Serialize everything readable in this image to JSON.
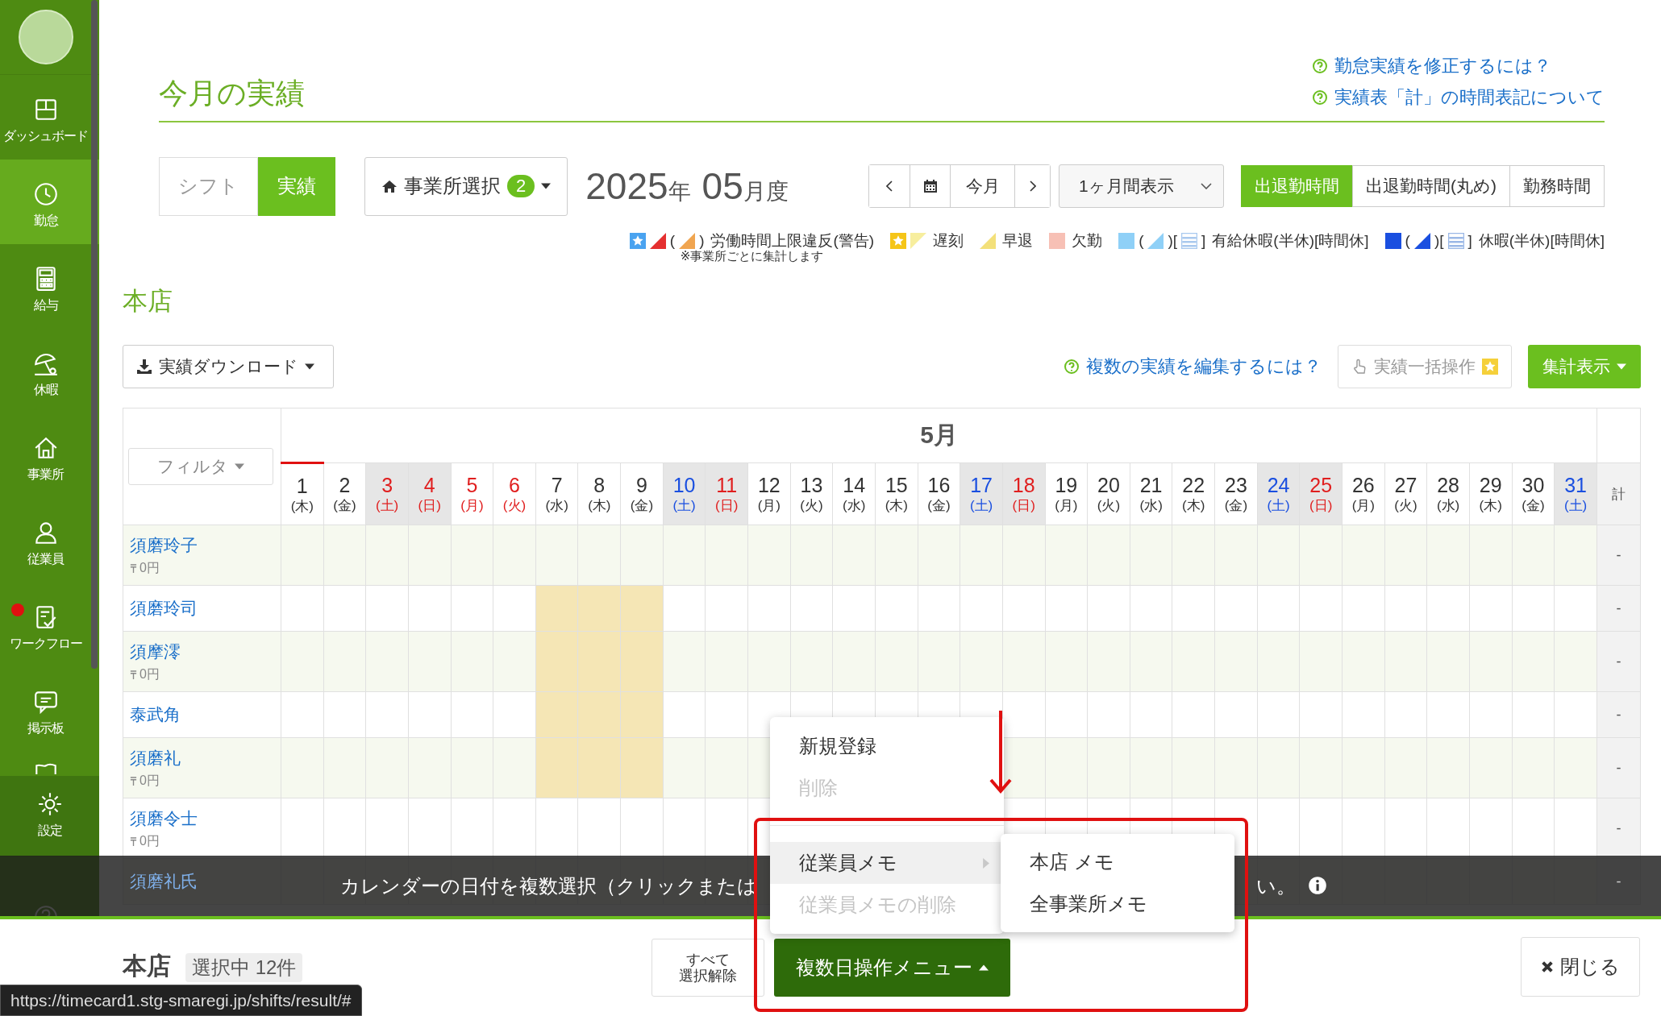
{
  "sidebar": {
    "items": [
      {
        "label": "ダッシュボード",
        "selected": false,
        "notification": false
      },
      {
        "label": "勤怠",
        "selected": true,
        "notification": false
      },
      {
        "label": "給与",
        "selected": false,
        "notification": false
      },
      {
        "label": "休暇",
        "selected": false,
        "notification": false
      },
      {
        "label": "事業所",
        "selected": false,
        "notification": false
      },
      {
        "label": "従業員",
        "selected": false,
        "notification": false
      },
      {
        "label": "ワークフロー",
        "selected": false,
        "notification": true
      },
      {
        "label": "掲示板",
        "selected": false,
        "notification": false
      }
    ],
    "settings": "設定"
  },
  "page_title": "今月の実績",
  "help_links": [
    "勤怠実績を修正するには？",
    "実績表「計」の時間表記について"
  ],
  "view_toggle": [
    {
      "label": "シフト",
      "selected": false
    },
    {
      "label": "実績",
      "selected": true
    }
  ],
  "office_select": {
    "label": "事業所選択",
    "badge": "2"
  },
  "period": {
    "year": "2025",
    "year_unit": "年",
    "month": "05",
    "month_unit": "月度"
  },
  "nav": {
    "today": "今月"
  },
  "range_select": {
    "value": "1ヶ月間表示"
  },
  "time_modes": [
    {
      "label": "出退勤時間",
      "selected": true
    },
    {
      "label": "出退勤時間(丸め)",
      "selected": false
    },
    {
      "label": "勤務時間",
      "selected": false
    }
  ],
  "legend": [
    {
      "marks": [
        {
          "kind": "star",
          "color": "#4aa3f0"
        },
        {
          "kind": "triangle",
          "color": "#e53030"
        },
        {
          "kind": "text",
          "text": "("
        },
        {
          "kind": "triangle",
          "color": "#f0a550"
        },
        {
          "kind": "text",
          "text": ")"
        }
      ],
      "label": "労働時間上限違反(警告)",
      "note": "※事業所ごとに集計します"
    },
    {
      "marks": [
        {
          "kind": "star",
          "color": "#f5c518"
        },
        {
          "kind": "corner",
          "color": "#f7ee9e"
        }
      ],
      "label": "遅刻"
    },
    {
      "marks": [
        {
          "kind": "triangle",
          "color": "#f3e07a"
        }
      ],
      "label": "早退"
    },
    {
      "marks": [
        {
          "kind": "square",
          "color": "#f7c0b5"
        }
      ],
      "label": "欠勤"
    },
    {
      "marks": [
        {
          "kind": "square",
          "color": "#8fd0f7"
        },
        {
          "kind": "text",
          "text": "("
        },
        {
          "kind": "triangle",
          "color": "#8fd0f7"
        },
        {
          "kind": "text",
          "text": ")["
        },
        {
          "kind": "stripes",
          "color": "#a9c9ee"
        },
        {
          "kind": "text",
          "text": "]"
        }
      ],
      "label": "有給休暇(半休)[時間休]"
    },
    {
      "marks": [
        {
          "kind": "square",
          "color": "#1a4fe0"
        },
        {
          "kind": "text",
          "text": "("
        },
        {
          "kind": "triangle",
          "color": "#1a4fe0"
        },
        {
          "kind": "text",
          "text": ")["
        },
        {
          "kind": "stripes",
          "color": "#9bb8e6"
        },
        {
          "kind": "text",
          "text": "]"
        }
      ],
      "label": "休暇(半休)[時間休]"
    }
  ],
  "store_name": "本店",
  "download_button": "実績ダウンロード",
  "multi_edit_link": "複数の実績を編集するには？",
  "bulk_button": {
    "label": "実績一括操作",
    "disabled": true
  },
  "summary_button": "集計表示",
  "table": {
    "filter": "フィルタ",
    "month": "5月",
    "total_header": "計",
    "days": [
      {
        "day": "1",
        "weekday": "(木)",
        "kind": "weekday",
        "today": true,
        "selected": false
      },
      {
        "day": "2",
        "weekday": "(金)",
        "kind": "weekday",
        "today": false,
        "selected": false
      },
      {
        "day": "3",
        "weekday": "(土)",
        "kind": "holiday_weekend",
        "today": false,
        "selected": false
      },
      {
        "day": "4",
        "weekday": "(日)",
        "kind": "sunday",
        "today": false,
        "selected": false
      },
      {
        "day": "5",
        "weekday": "(月)",
        "kind": "holiday",
        "today": false,
        "selected": false
      },
      {
        "day": "6",
        "weekday": "(火)",
        "kind": "holiday",
        "today": false,
        "selected": false
      },
      {
        "day": "7",
        "weekday": "(水)",
        "kind": "weekday",
        "today": false,
        "selected": true
      },
      {
        "day": "8",
        "weekday": "(木)",
        "kind": "weekday",
        "today": false,
        "selected": true
      },
      {
        "day": "9",
        "weekday": "(金)",
        "kind": "weekday",
        "today": false,
        "selected": true
      },
      {
        "day": "10",
        "weekday": "(土)",
        "kind": "saturday",
        "today": false,
        "selected": false
      },
      {
        "day": "11",
        "weekday": "(日)",
        "kind": "sunday",
        "today": false,
        "selected": false
      },
      {
        "day": "12",
        "weekday": "(月)",
        "kind": "weekday",
        "today": false,
        "selected": false
      },
      {
        "day": "13",
        "weekday": "(火)",
        "kind": "weekday",
        "today": false,
        "selected": false
      },
      {
        "day": "14",
        "weekday": "(水)",
        "kind": "weekday",
        "today": false,
        "selected": false
      },
      {
        "day": "15",
        "weekday": "(木)",
        "kind": "weekday",
        "today": false,
        "selected": false
      },
      {
        "day": "16",
        "weekday": "(金)",
        "kind": "weekday",
        "today": false,
        "selected": false
      },
      {
        "day": "17",
        "weekday": "(土)",
        "kind": "saturday",
        "today": false,
        "selected": false
      },
      {
        "day": "18",
        "weekday": "(日)",
        "kind": "sunday",
        "today": false,
        "selected": false
      },
      {
        "day": "19",
        "weekday": "(月)",
        "kind": "weekday",
        "today": false,
        "selected": false
      },
      {
        "day": "20",
        "weekday": "(火)",
        "kind": "weekday",
        "today": false,
        "selected": false
      },
      {
        "day": "21",
        "weekday": "(水)",
        "kind": "weekday",
        "today": false,
        "selected": false
      },
      {
        "day": "22",
        "weekday": "(木)",
        "kind": "weekday",
        "today": false,
        "selected": false
      },
      {
        "day": "23",
        "weekday": "(金)",
        "kind": "weekday",
        "today": false,
        "selected": false
      },
      {
        "day": "24",
        "weekday": "(土)",
        "kind": "saturday",
        "today": false,
        "selected": false
      },
      {
        "day": "25",
        "weekday": "(日)",
        "kind": "sunday",
        "today": false,
        "selected": false
      },
      {
        "day": "26",
        "weekday": "(月)",
        "kind": "weekday",
        "today": false,
        "selected": false
      },
      {
        "day": "27",
        "weekday": "(火)",
        "kind": "weekday",
        "today": false,
        "selected": false
      },
      {
        "day": "28",
        "weekday": "(水)",
        "kind": "weekday",
        "today": false,
        "selected": false
      },
      {
        "day": "29",
        "weekday": "(木)",
        "kind": "weekday",
        "today": false,
        "selected": false
      },
      {
        "day": "30",
        "weekday": "(金)",
        "kind": "weekday",
        "today": false,
        "selected": false
      },
      {
        "day": "31",
        "weekday": "(土)",
        "kind": "saturday",
        "today": false,
        "selected": false
      }
    ],
    "rows": [
      {
        "name": "須磨玲子",
        "wage": "0円",
        "total": "-",
        "selected": false
      },
      {
        "name": "須磨玲司",
        "total": "-",
        "selected": true
      },
      {
        "name": "須摩澪",
        "wage": "0円",
        "total": "-",
        "selected": true
      },
      {
        "name": "泰武角",
        "total": "-",
        "selected": true
      },
      {
        "name": "須磨礼",
        "wage": "0円",
        "total": "-",
        "selected": true
      },
      {
        "name": "須磨令士",
        "wage": "0円",
        "total": "-",
        "selected": false
      },
      {
        "name": "須磨礼氏",
        "total": "-"
      }
    ]
  },
  "banner": {
    "text_start": "カレンダーの日付を複数選択（クリックまたは",
    "text_end": "い。"
  },
  "menu": {
    "groups": [
      [
        {
          "label": "新規登録",
          "disabled": false,
          "selected": false,
          "submenu": false
        },
        {
          "label": "削除",
          "disabled": true,
          "selected": false,
          "submenu": false
        }
      ],
      [
        {
          "label": "従業員メモ",
          "disabled": false,
          "selected": true,
          "submenu": true
        },
        {
          "label": "従業員メモの削除",
          "disabled": true,
          "selected": false,
          "submenu": false
        }
      ]
    ],
    "submenu": [
      "本店 メモ",
      "全事業所メモ"
    ]
  },
  "footer": {
    "store": "本店",
    "selection": "選択中 12件",
    "clear_button": [
      "すべて",
      "選択解除"
    ],
    "menu_button": "複数日操作メニュー",
    "close_button": "閉じる"
  },
  "status_url": "https://timecard1.stg-smaregi.jp/shifts/result/#"
}
